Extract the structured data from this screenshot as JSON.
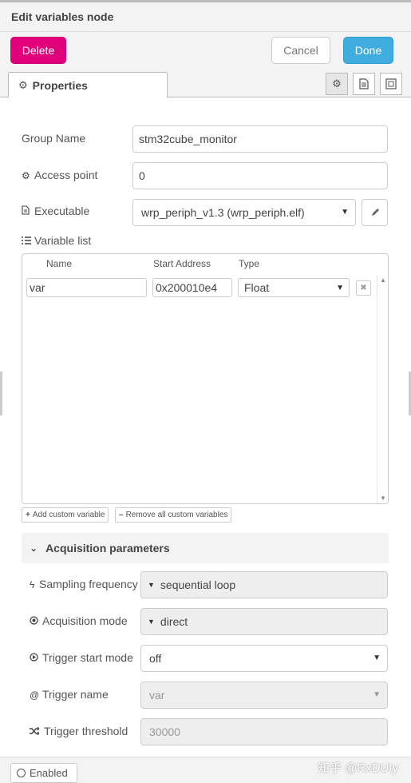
{
  "dialog": {
    "title": "Edit variables node"
  },
  "toolbar": {
    "delete_label": "Delete",
    "cancel_label": "Cancel",
    "done_label": "Done"
  },
  "tabs": {
    "properties_label": "Properties",
    "icons": [
      "gear-icon",
      "document-icon",
      "frame-icon"
    ]
  },
  "form": {
    "group_name": {
      "label": "Group Name",
      "value": "stm32cube_monitor"
    },
    "access_point": {
      "label": "Access point",
      "value": "0"
    },
    "executable": {
      "label": "Executable",
      "value": "wrp_periph_v1.3 (wrp_periph.elf)"
    },
    "variable_list": {
      "label": "Variable list",
      "headers": [
        "Name",
        "Start Address",
        "Type"
      ],
      "rows": [
        {
          "name": "var",
          "address": "0x200010e4",
          "type": "Float"
        }
      ],
      "add_label": "Add custom variable",
      "remove_label": "Remove all custom variables"
    }
  },
  "acquisition": {
    "title": "Acquisition parameters",
    "sampling_frequency": {
      "label": "Sampling frequency",
      "value": "sequential loop"
    },
    "acquisition_mode": {
      "label": "Acquisition mode",
      "value": "direct"
    },
    "trigger_start_mode": {
      "label": "Trigger start mode",
      "value": "off"
    },
    "trigger_name": {
      "label": "Trigger name",
      "value": "var"
    },
    "trigger_threshold": {
      "label": "Trigger threshold",
      "placeholder": "30000"
    }
  },
  "footer": {
    "enabled_label": "Enabled",
    "watermark": "知乎 @RxDUty"
  }
}
